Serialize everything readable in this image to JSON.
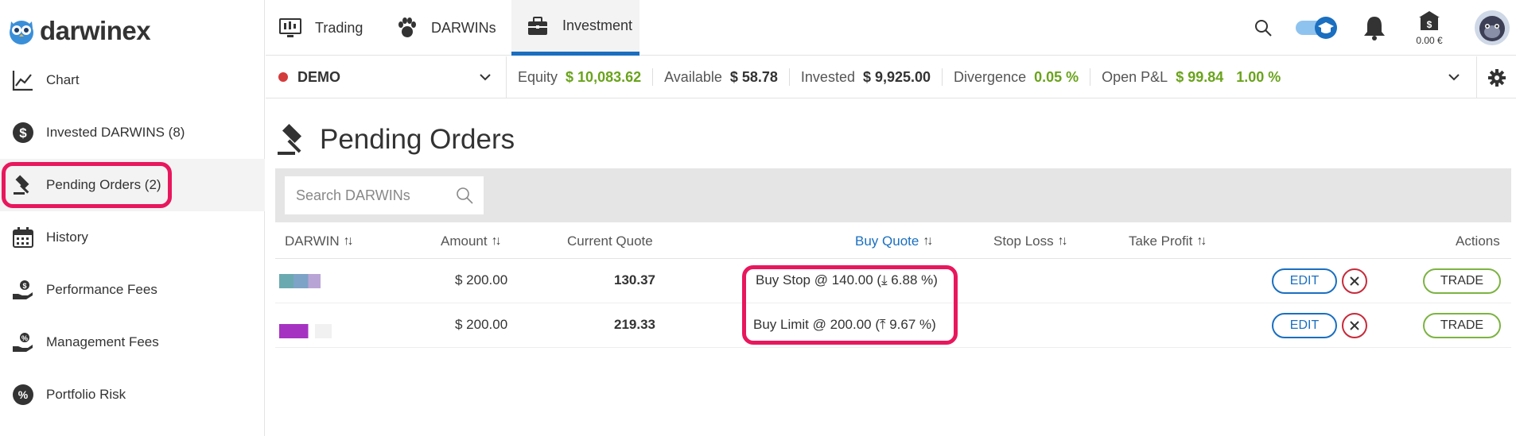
{
  "brand": {
    "name": "darwinex"
  },
  "sidebar": {
    "items": [
      {
        "label": "Chart",
        "icon": "chart-line-icon"
      },
      {
        "label": "Invested DARWINS (8)",
        "icon": "dollar-circle-icon"
      },
      {
        "label": "Pending Orders (2)",
        "icon": "gavel-icon",
        "active": true
      },
      {
        "label": "History",
        "icon": "calendar-icon"
      },
      {
        "label": "Performance Fees",
        "icon": "hand-coin-icon"
      },
      {
        "label": "Management Fees",
        "icon": "hand-percent-icon"
      },
      {
        "label": "Portfolio Risk",
        "icon": "percent-circle-icon"
      }
    ]
  },
  "topnav": {
    "tabs": [
      {
        "label": "Trading",
        "icon": "candlestick-monitor-icon"
      },
      {
        "label": "DARWINs",
        "icon": "paw-icon"
      },
      {
        "label": "Investment",
        "icon": "briefcase-icon",
        "active": true
      }
    ],
    "wallet_amount": "0.00 €"
  },
  "account": {
    "name": "DEMO",
    "equity_label": "Equity",
    "equity_value": "$ 10,083.62",
    "available_label": "Available",
    "available_value": "$ 58.78",
    "invested_label": "Invested",
    "invested_value": "$ 9,925.00",
    "divergence_label": "Divergence",
    "divergence_value": "0.05 %",
    "pnl_label": "Open P&L",
    "pnl_value": "$ 99.84",
    "pnl_pct": "1.00 %"
  },
  "page": {
    "title": "Pending Orders",
    "search_placeholder": "Search DARWINs"
  },
  "table": {
    "headers": {
      "darwin": "DARWIN",
      "amount": "Amount",
      "current_quote": "Current Quote",
      "buy_quote": "Buy Quote",
      "stop_loss": "Stop Loss",
      "take_profit": "Take Profit",
      "actions": "Actions"
    },
    "rows": [
      {
        "amount": "$ 200.00",
        "current_quote": "130.37",
        "buy_quote": "Buy Stop @ 140.00 (⤓ 6.88 %)",
        "edit": "EDIT",
        "trade": "TRADE"
      },
      {
        "amount": "$ 200.00",
        "current_quote": "219.33",
        "buy_quote": "Buy Limit @ 200.00 (⤒ 9.67 %)",
        "edit": "EDIT",
        "trade": "TRADE"
      }
    ]
  },
  "colors": {
    "accent": "#1a6fc0",
    "positive": "#6aa31c",
    "highlight": "#e8175d",
    "danger": "#c72a3a",
    "trade": "#7cb342"
  }
}
